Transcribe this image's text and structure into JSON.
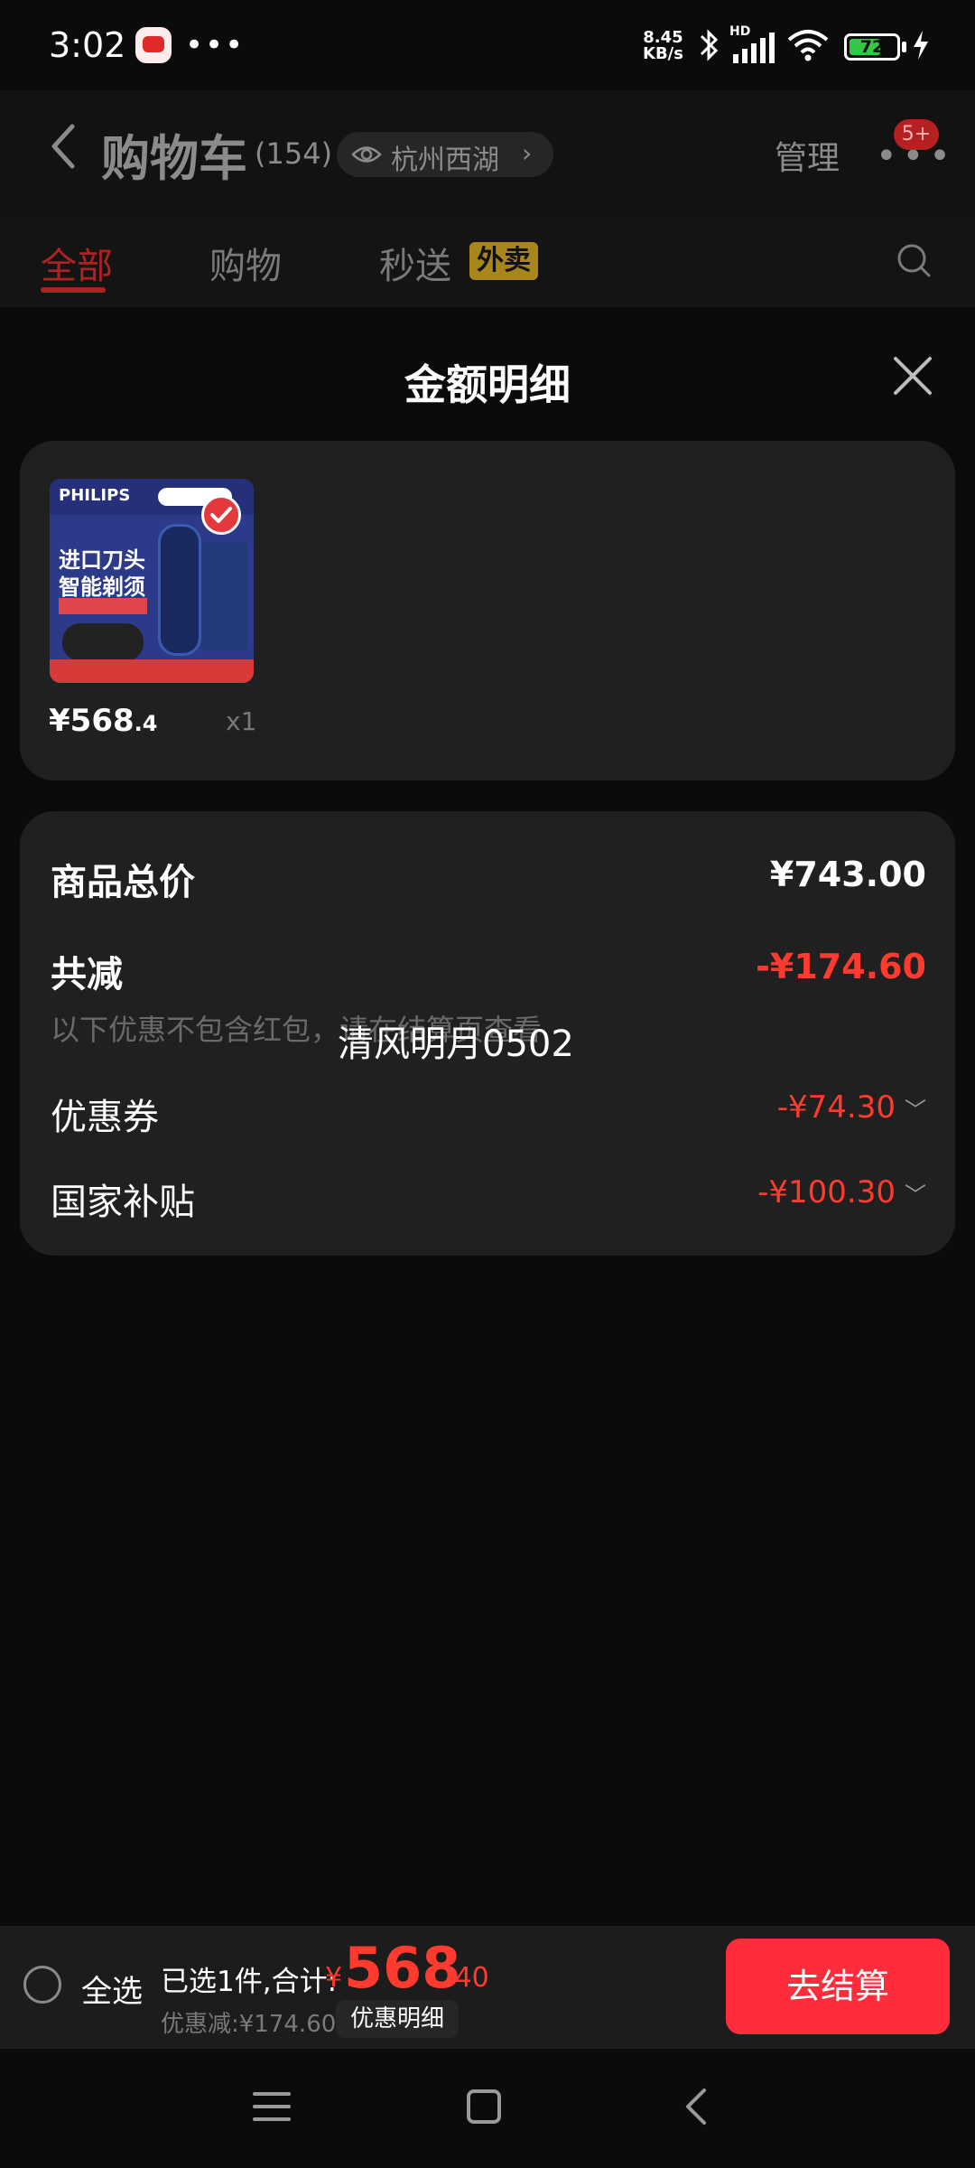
{
  "status_bar": {
    "time": "3:02",
    "speed_top": "8.45",
    "speed_bottom": "KB/s",
    "hd": "HD",
    "battery": "72"
  },
  "header": {
    "title": "购物车",
    "count": "(154)",
    "location": "杭州西湖",
    "manage": "管理",
    "more": "•••",
    "badge": "5+"
  },
  "tabs": [
    {
      "label": "全部"
    },
    {
      "label": "购物"
    },
    {
      "label": "秒送"
    }
  ],
  "tab_tag": "外卖",
  "sheet": {
    "title": "金额明细"
  },
  "product": {
    "brand": "PHILIPS",
    "line1": "进口刀头",
    "line2": "智能剃须",
    "price_main": "¥568",
    "price_dec": ".4",
    "qty": "x1"
  },
  "summary": {
    "total_label": "商品总价",
    "total_value": "¥743.00",
    "reduce_label": "共减",
    "reduce_value": "-¥174.60",
    "note": "以下优惠不包含红包，请在结算页查看",
    "watermark": "清风明月0502",
    "coupon_label": "优惠券",
    "coupon_value": "-¥74.30",
    "subsidy_label": "国家补贴",
    "subsidy_value": "-¥100.30",
    "caret": "﹀"
  },
  "bottom_bar": {
    "select_all": "全选",
    "selected_info": "已选1件,合计:",
    "yen": "¥",
    "total_int": "568",
    "total_dec": ".40",
    "discount": "优惠减:¥174.60",
    "detail": "优惠明细",
    "checkout": "去结算"
  }
}
